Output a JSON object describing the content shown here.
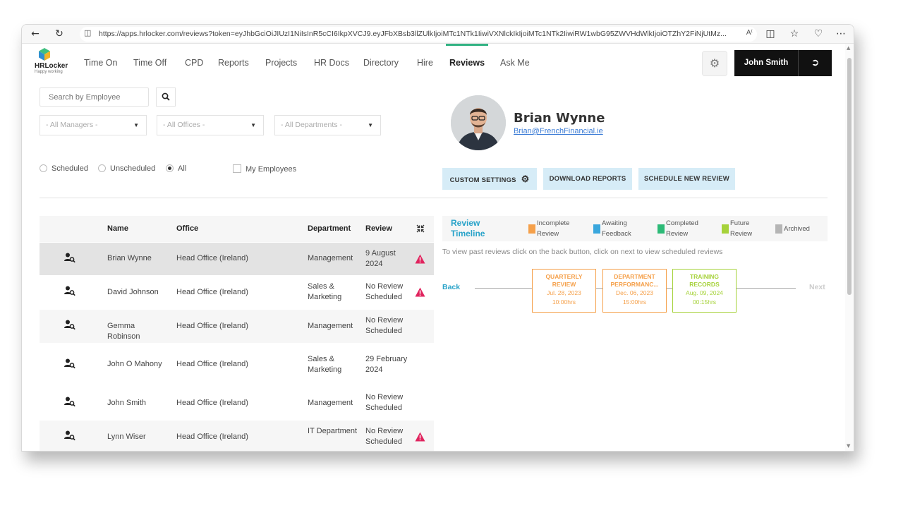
{
  "browser": {
    "url": "https://apps.hrlocker.com/reviews?token=eyJhbGciOiJIUzI1NiIsInR5cCI6IkpXVCJ9.eyJFbXBsb3llZUlkIjoiMTc1NTk1IiwiVXNlckIkIjoiMTc1NTk2IiwiRW1wbG95ZWVHdWlkIjoiOTZhY2FiNjUtMz...",
    "icons": [
      "back-icon",
      "refresh-icon",
      "lock-icon",
      "read-aloud-icon",
      "split-screen-icon",
      "favorites-icon",
      "collections-icon",
      "more-icon"
    ]
  },
  "header": {
    "logo_text": "HRLocker",
    "logo_tagline": "Happy working",
    "nav": [
      "Time On",
      "Time Off",
      "CPD",
      "Reports",
      "Projects",
      "HR Docs",
      "Directory",
      "Hire",
      "Reviews",
      "Ask Me"
    ],
    "active_nav": "Reviews",
    "user_name": "John Smith",
    "accent_color": "#33b384"
  },
  "filters": {
    "search_placeholder": "Search by Employee",
    "managers": "- All Managers -",
    "offices": "- All Offices -",
    "departments": "- All Departments -",
    "radios": [
      "Scheduled",
      "Unscheduled",
      "All"
    ],
    "selected_radio": "All",
    "my_employees": "My Employees"
  },
  "table": {
    "headers": {
      "name": "Name",
      "office": "Office",
      "department": "Department",
      "review": "Review"
    },
    "rows": [
      {
        "name": "Brian Wynne",
        "office": "Head Office (Ireland)",
        "department": "Management",
        "review": "9 August 2024",
        "warning": true
      },
      {
        "name": "David Johnson",
        "office": "Head Office (Ireland)",
        "department": "Sales & Marketing",
        "review": "No Review Scheduled",
        "warning": true
      },
      {
        "name": "Gemma Robinson",
        "office": "Head Office (Ireland)",
        "department": "Management",
        "review": "No Review Scheduled",
        "warning": false
      },
      {
        "name": "John O Mahony",
        "office": "Head Office (Ireland)",
        "department": "Sales & Marketing",
        "review": "29 February 2024",
        "warning": false
      },
      {
        "name": "John Smith",
        "office": "Head Office (Ireland)",
        "department": "Management",
        "review": "No Review Scheduled",
        "warning": false
      },
      {
        "name": "Lynn Wiser",
        "office": "Head Office (Ireland)",
        "department": "IT Department",
        "review": "No Review Scheduled",
        "warning": true
      }
    ],
    "warning_color": "#e0245e"
  },
  "profile": {
    "name": "Brian Wynne",
    "email": "Brian@FrenchFinancial.ie",
    "buttons": {
      "custom_settings": "CUSTOM SETTINGS",
      "download_reports": "DOWNLOAD REPORTS",
      "schedule_review": "SCHEDULE NEW REVIEW"
    }
  },
  "timeline": {
    "title_1": "Review",
    "title_2": "Timeline",
    "legend": [
      {
        "l1": "Incomplete",
        "l2": "Review",
        "color": "#f5a04a"
      },
      {
        "l1": "Awaiting",
        "l2": "Feedback",
        "color": "#3aa7dd"
      },
      {
        "l1": "Completed",
        "l2": "Review",
        "color": "#2dba77"
      },
      {
        "l1": "Future",
        "l2": "Review",
        "color": "#a6d23a"
      },
      {
        "l1": "Archived",
        "l2": "",
        "color": "#b5b5b5"
      }
    ],
    "hint": "To view past reviews click on the back button, click on next to view scheduled reviews",
    "back": "Back",
    "next": "Next",
    "cards": [
      {
        "title": "QUARTERLY REVIEW",
        "date": "Jul. 28, 2023",
        "time": "10:00hrs",
        "color": "#f5a04a"
      },
      {
        "title": "DEPARTMENT PERFORMANC...",
        "date": "Dec. 06, 2023",
        "time": "15:00hrs",
        "color": "#f5a04a"
      },
      {
        "title": "TRAINING RECORDS",
        "date": "Aug. 09, 2024",
        "time": "00:15hrs",
        "color": "#a6d23a"
      }
    ]
  }
}
